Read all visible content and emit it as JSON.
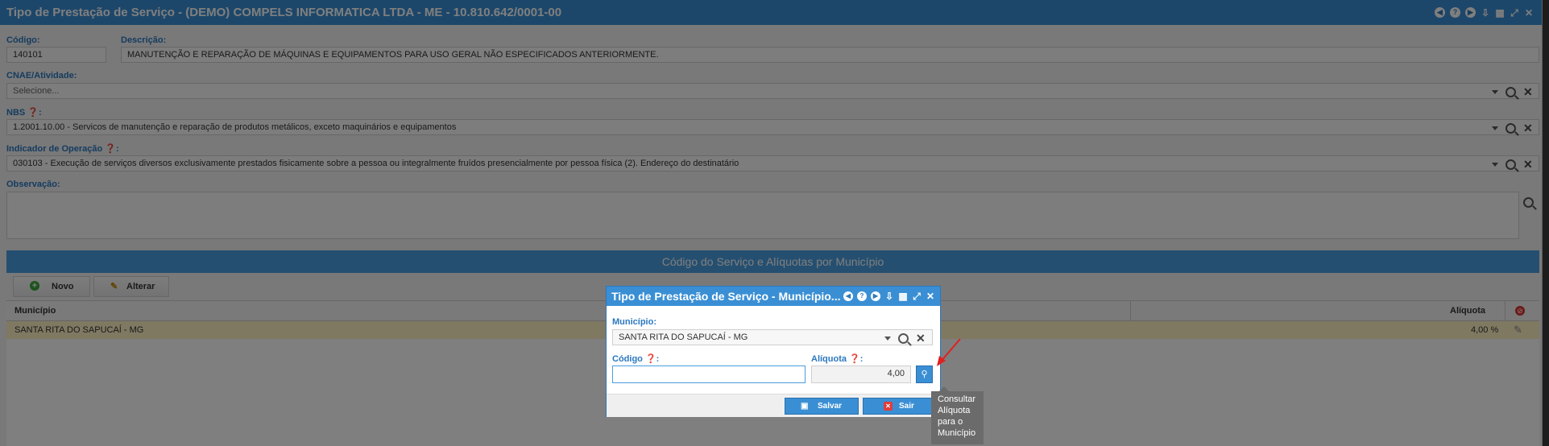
{
  "window": {
    "title": "Tipo de Prestação de Serviço - (DEMO) COMPELS INFORMATICA LTDA - ME - 10.810.642/0001-00"
  },
  "form": {
    "codigo_label": "Código:",
    "codigo_value": "140101",
    "descricao_label": "Descrição:",
    "descricao_value": "MANUTENÇÃO E REPARAÇÃO DE MÁQUINAS E EQUIPAMENTOS PARA USO GERAL NÃO ESPECIFICADOS ANTERIORMENTE.",
    "cnae_label": "CNAE/Atividade:",
    "cnae_placeholder": "Selecione...",
    "nbs_label": "NBS",
    "nbs_value": "1.2001.10.00 - Servicos de manutenção e reparação de produtos metálicos, exceto maquinários e equipamentos",
    "indicador_label": "Indicador de Operação",
    "indicador_value": "030103 - Execução de serviços diversos exclusivamente prestados fisicamente sobre a pessoa ou integralmente fruídos presencialmente por pessoa física (2). Endereço do destinatário",
    "observacao_label": "Observação:",
    "observacao_value": ""
  },
  "panel": {
    "title": "Código do Serviço e Alíquotas por Município",
    "novo_label": "Novo",
    "alterar_label": "Alterar",
    "columns": [
      "Município",
      "Alíquota"
    ],
    "rows": [
      {
        "municipio": "SANTA RITA DO SAPUCAÍ - MG",
        "aliquota": "4,00 %"
      }
    ]
  },
  "dialog": {
    "title": "Tipo de Prestação de Serviço - Município...",
    "municipio_label": "Município:",
    "municipio_value": "SANTA RITA DO SAPUCAÍ - MG",
    "codigo_label": "Código",
    "codigo_value": "",
    "aliquota_label": "Alíquota",
    "aliquota_value": "4,00",
    "salvar_label": "Salvar",
    "sair_label": "Sair"
  },
  "tooltip": {
    "text": "Consultar Alíquota para o Município"
  },
  "colors": {
    "accent": "#3a8fd4",
    "label": "#2a78c0",
    "row_highlight": "#fff3c4",
    "arrow": "#e02020"
  },
  "icons": [
    "nav-prev-icon",
    "help-icon",
    "nav-next-icon",
    "download-icon",
    "calendar-icon",
    "maximize-icon",
    "close-icon",
    "search-icon",
    "clear-icon",
    "chevron-down-icon",
    "add-icon",
    "edit-icon",
    "save-icon",
    "exit-icon"
  ]
}
